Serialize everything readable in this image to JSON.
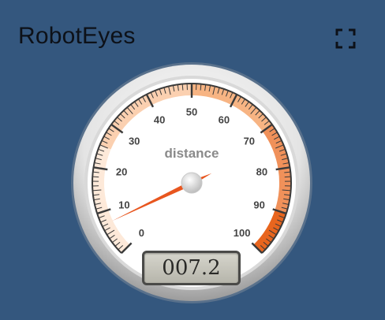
{
  "card": {
    "title": "RobotEyes",
    "fullscreen_icon": "fullscreen-icon"
  },
  "gauge": {
    "title": "distance",
    "value": 7.2,
    "display_value": "007.2",
    "min": 0,
    "max": 100,
    "major_ticks": [
      "0",
      "10",
      "20",
      "30",
      "40",
      "50",
      "60",
      "70",
      "80",
      "90",
      "100"
    ],
    "minor_ticks_per_major": 10,
    "highlights": [
      {
        "from": 0,
        "to": 25,
        "color": "#fde9d9"
      },
      {
        "from": 25,
        "to": 50,
        "color": "#fbd0b0"
      },
      {
        "from": 50,
        "to": 70,
        "color": "#f7b483"
      },
      {
        "from": 70,
        "to": 90,
        "color": "#f0915a"
      },
      {
        "from": 90,
        "to": 100,
        "color": "#e8651e"
      }
    ],
    "needle_color": "#e8561f"
  },
  "colors": {
    "background": "#34577e",
    "title": "#0d1118",
    "plate": "#ffffff",
    "tick": "#3a3a3a",
    "label": "#444444",
    "gauge_title": "#8a8a8a"
  }
}
